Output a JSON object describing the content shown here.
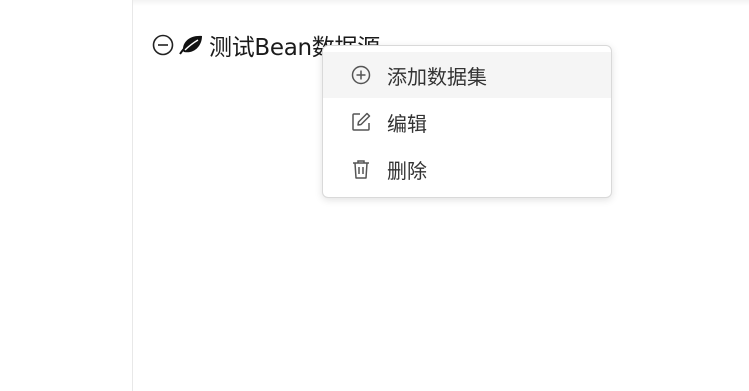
{
  "tree": {
    "node_label": "测试Bean数据源",
    "collapse_icon": "minus-circle-icon",
    "node_icon": "leaf-icon"
  },
  "context_menu": {
    "items": [
      {
        "label": "添加数据集",
        "icon": "plus-circle-icon"
      },
      {
        "label": "编辑",
        "icon": "edit-icon"
      },
      {
        "label": "删除",
        "icon": "trash-icon"
      }
    ]
  },
  "colors": {
    "menu_hover_bg": "#f5f5f5",
    "menu_text": "#333333",
    "node_text": "#1a1a1a",
    "icon_stroke": "#555555"
  }
}
